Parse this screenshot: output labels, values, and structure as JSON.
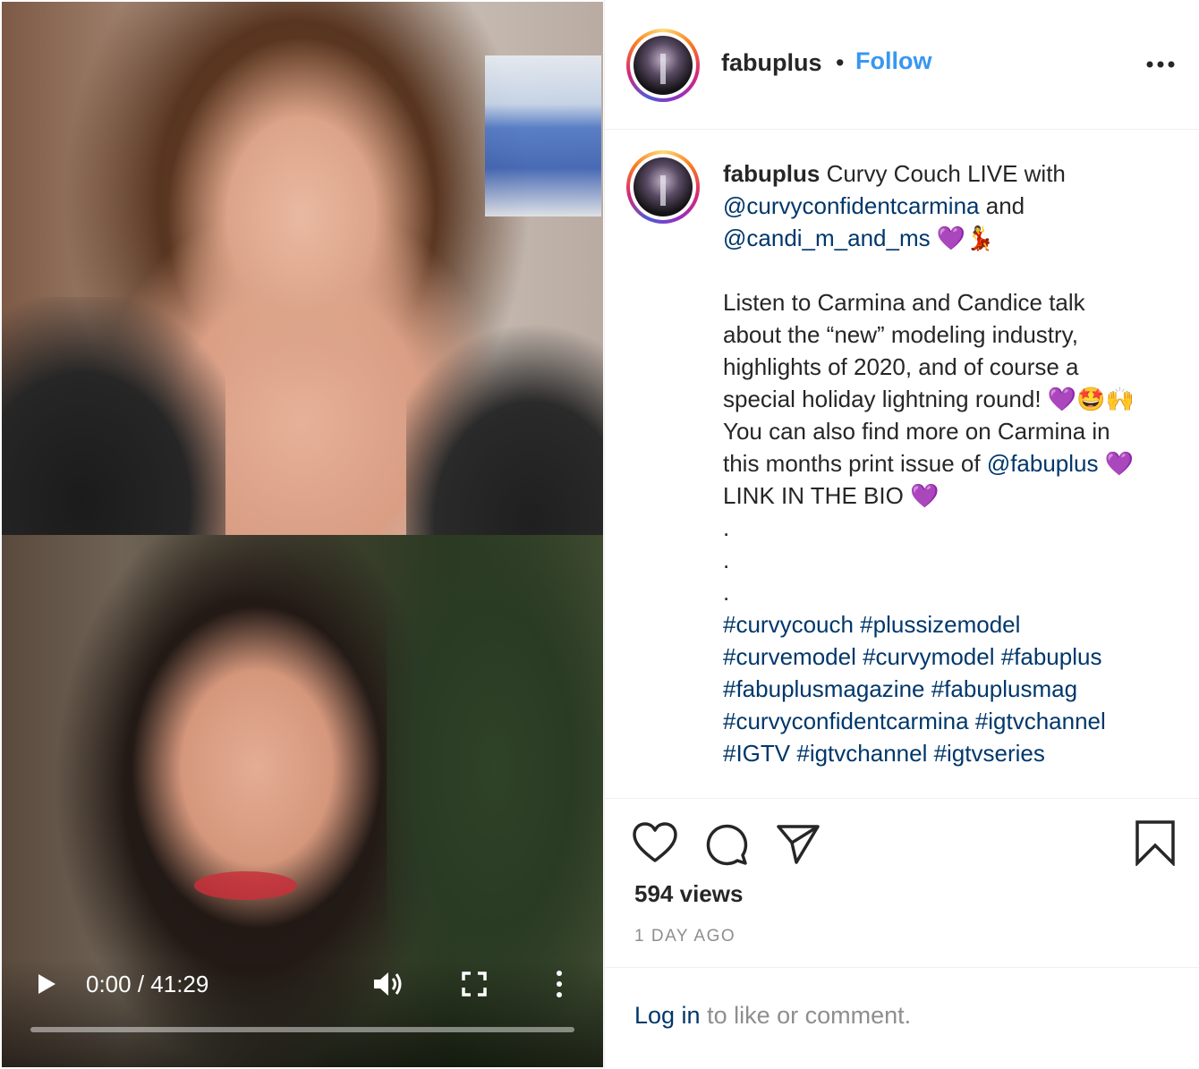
{
  "video": {
    "current_time": "0:00",
    "duration": "41:29",
    "progress": 0
  },
  "header": {
    "username": "fabuplus",
    "separator": "•",
    "follow_label": "Follow"
  },
  "caption": {
    "username": "fabuplus",
    "line1_text": " Curvy Couch LIVE with",
    "mention1": "@curvyconfidentcarmina",
    "and_text": " and",
    "mention2": "@candi_m_and_ms",
    "emoji1": " 💜💃",
    "para2_l1": "Listen to Carmina and Candice talk",
    "para2_l2": "about the “new” modeling industry,",
    "para2_l3": "highlights of 2020, and of course a",
    "para2_l4": "special holiday lightning round! 💜🤩🙌",
    "para2_l5": "You can also find more on Carmina in",
    "para2_l6_text": "this months print issue of ",
    "mention3": "@fabuplus",
    "para2_l6_emoji": " 💜",
    "para2_l7": "LINK IN THE BIO 💜",
    "dot1": ".",
    "dot2": ".",
    "dot3": ".",
    "tags_l1": "#curvycouch #plussizemodel",
    "tags_l2": "#curvemodel #curvymodel #fabuplus",
    "tags_l3": "#fabuplusmagazine #fabuplusmag",
    "tags_l4": "#curvyconfidentcarmina #igtvchannel",
    "tags_l5": "#IGTV #igtvchannel #igtvseries"
  },
  "stats": {
    "views": "594 views",
    "time_ago": "1 DAY AGO"
  },
  "footer": {
    "login_link": "Log in",
    "login_text": " to like or comment."
  },
  "colors": {
    "follow": "#3897f0",
    "link": "#00376b",
    "muted": "#8e8e8e",
    "text": "#262626"
  },
  "icons": [
    "play-icon",
    "volume-icon",
    "fullscreen-icon",
    "more-vertical-icon",
    "more-horizontal-icon",
    "heart-icon",
    "comment-icon",
    "share-icon",
    "bookmark-icon"
  ]
}
